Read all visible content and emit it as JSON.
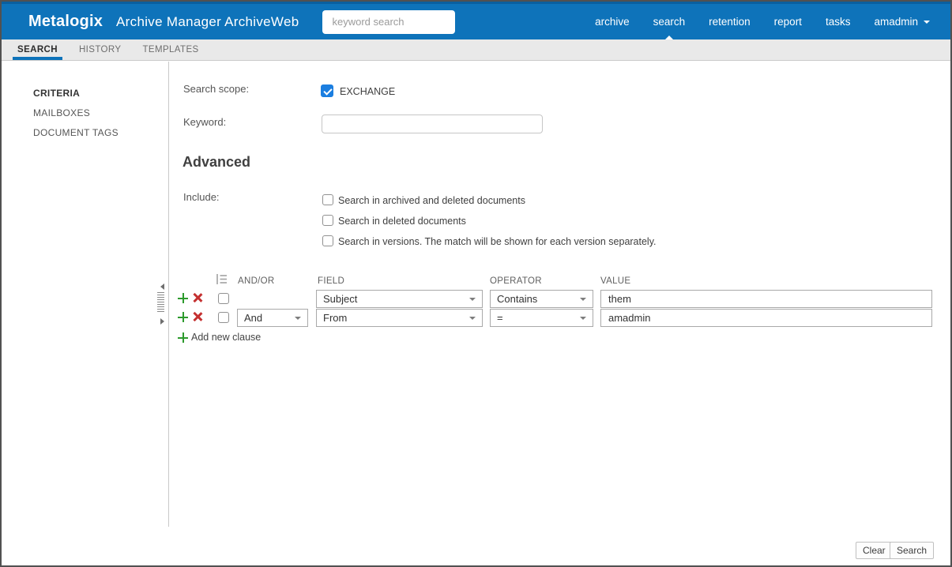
{
  "header": {
    "logo": "Metalogix",
    "app_title": "Archive Manager ArchiveWeb",
    "search_placeholder": "keyword search",
    "nav": [
      {
        "label": "archive"
      },
      {
        "label": "search"
      },
      {
        "label": "retention"
      },
      {
        "label": "report"
      },
      {
        "label": "tasks"
      },
      {
        "label": "amadmin"
      }
    ]
  },
  "tabs": [
    {
      "label": "SEARCH"
    },
    {
      "label": "HISTORY"
    },
    {
      "label": "TEMPLATES"
    }
  ],
  "sidebar": {
    "items": [
      {
        "label": "CRITERIA"
      },
      {
        "label": "MAILBOXES"
      },
      {
        "label": "DOCUMENT TAGS"
      }
    ]
  },
  "form": {
    "search_scope_label": "Search scope:",
    "scope_option": "EXCHANGE",
    "scope_checked": true,
    "keyword_label": "Keyword:",
    "keyword_value": "",
    "advanced_heading": "Advanced",
    "include_label": "Include:",
    "include_options": [
      {
        "label": "Search in archived and deleted documents",
        "checked": false
      },
      {
        "label": "Search in deleted documents",
        "checked": false
      },
      {
        "label": "Search in versions. The match will be shown for each version separately.",
        "checked": false
      }
    ]
  },
  "clauses": {
    "columns": {
      "andor": "AND/OR",
      "field": "FIELD",
      "operator": "OPERATOR",
      "value": "VALUE"
    },
    "rows": [
      {
        "andor": "",
        "field": "Subject",
        "operator": "Contains",
        "value": "them"
      },
      {
        "andor": "And",
        "field": "From",
        "operator": "=",
        "value": "amadmin"
      }
    ],
    "add_new_label": "Add new clause"
  },
  "footer": {
    "clear_label": "Clear",
    "search_label": "Search"
  },
  "colors": {
    "header_blue": "#0e73ba",
    "accent_blue": "#1b7ee0",
    "tab_underline": "#0e73ba",
    "plus_green": "#2c9a2c",
    "delete_red": "#c43030"
  }
}
